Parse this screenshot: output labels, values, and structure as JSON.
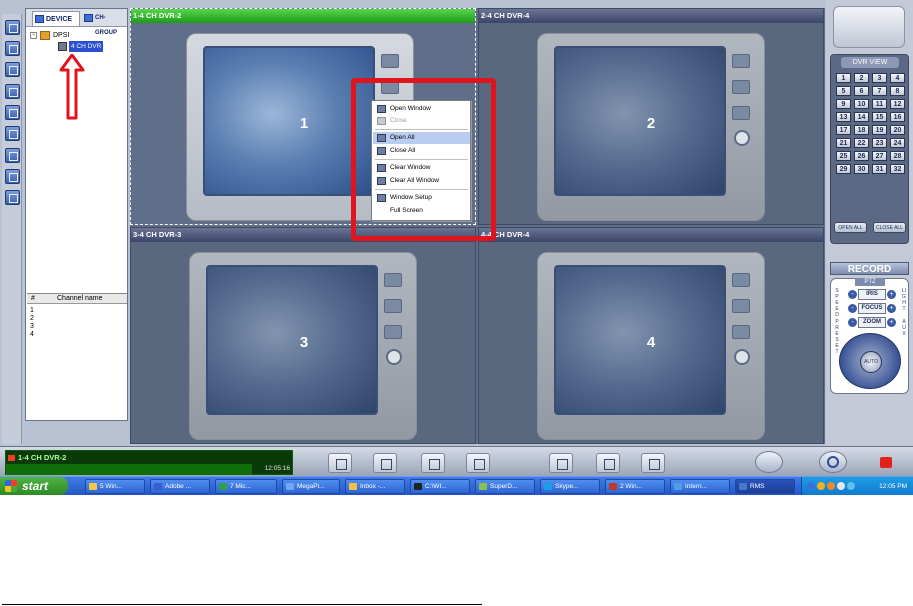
{
  "device_panel": {
    "tabs": [
      "DEVICE",
      "CH-GROUP"
    ],
    "tree": {
      "root": "DPSI",
      "dvr": "4 CH DVR"
    },
    "channel_headers": [
      "#",
      "Channel name"
    ],
    "channels": [
      "1",
      "2",
      "3",
      "4"
    ]
  },
  "video_windows": [
    {
      "title": "1-4 CH DVR-2",
      "number": "1",
      "active": true
    },
    {
      "title": "2-4 CH DVR-4",
      "number": "2",
      "active": false
    },
    {
      "title": "3-4 CH DVR-3",
      "number": "3",
      "active": false
    },
    {
      "title": "4-4 CH DVR-4",
      "number": "4",
      "active": false
    }
  ],
  "context_menu": {
    "items": [
      "Open Window",
      "Close",
      "Open All",
      "Close All",
      "Clear Window",
      "Clear All Window",
      "Window Setup",
      "Full Screen"
    ],
    "disabled": [
      "Close"
    ],
    "highlighted": "Open All"
  },
  "right_panel": {
    "dvr_view_title": "DVR VIEW",
    "channel_buttons": [
      "1",
      "2",
      "3",
      "4",
      "5",
      "6",
      "7",
      "8",
      "9",
      "10",
      "11",
      "12",
      "13",
      "14",
      "15",
      "16",
      "17",
      "18",
      "19",
      "20",
      "21",
      "22",
      "23",
      "24",
      "25",
      "26",
      "27",
      "28",
      "29",
      "30",
      "31",
      "32"
    ],
    "open_all": "OPEN ALL",
    "close_all": "CLOSE ALL",
    "record": "RECORD",
    "ptz": {
      "title": "PTZ",
      "left_labels": [
        "SPEED",
        "PRESET"
      ],
      "right_labels": [
        "LIGHT",
        "AUX"
      ],
      "iris": "IRIS",
      "focus": "FOCUS",
      "zoom": "ZOOM",
      "auto": "AUTO"
    }
  },
  "status": {
    "title": "1-4 CH DVR-2",
    "time": "12:05:16"
  },
  "taskbar": {
    "start": "start",
    "items": [
      "5 Win...",
      "Adobe ...",
      "7 Mic...",
      "MegaPi...",
      "Inbox -...",
      "C:\\WI...",
      "SuperD...",
      "Skype...",
      "2 Win...",
      "Intern...",
      "RMS"
    ],
    "clock": "12:05 PM"
  },
  "colors": {
    "accent_green": "#1f9a18",
    "annotation_red": "#e0141c",
    "taskbar_blue": "#2457c5"
  }
}
